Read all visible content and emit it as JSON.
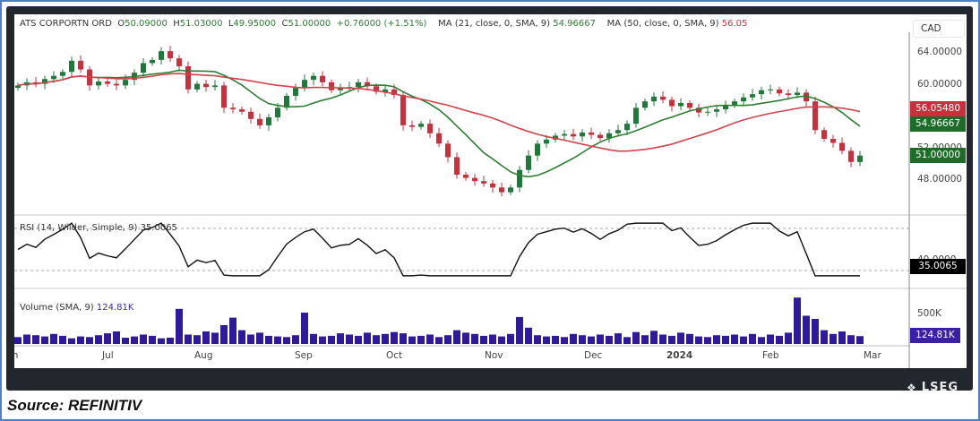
{
  "header": {
    "symbol": "ATS CORPORTN ORD",
    "open": "O50.09000",
    "high": "H51.03000",
    "low": "L49.95000",
    "close": "C51.00000",
    "change": "+0.76000 (+1.51%)",
    "ma21_label": "MA (21, close, 0, SMA, 9)",
    "ma21_value": "54.96667",
    "ma50_label": "MA (50, close, 0, SMA, 9)",
    "ma50_value": "56.05"
  },
  "currency": "CAD",
  "price_axis": [
    "64.00000",
    "60.00000",
    "52.00000",
    "48.00000"
  ],
  "price_tags": {
    "ma50": "56.05480",
    "ma21": "54.96667",
    "last": "51.00000"
  },
  "rsi": {
    "label": "RSI (14, Wilder, Simple, 9)",
    "value": "35.0065",
    "axis": "40.0000"
  },
  "volume": {
    "label": "Volume (SMA, 9)",
    "value": "124.81K",
    "axis": "500K"
  },
  "time_axis": [
    "Jun",
    "Jul",
    "Aug",
    "Sep",
    "Oct",
    "Nov",
    "Dec",
    "2024",
    "Feb",
    "Mar"
  ],
  "brand": "LSEG",
  "source": "Source: REFINITIV",
  "colors": {
    "up": "#1f7a3a",
    "down": "#cc2f3c",
    "ma21": "#2e7d32",
    "ma50": "#d2424b",
    "volume": "#2f1a9c",
    "rsi": "#111111"
  },
  "chart_data": {
    "type": "candlestick",
    "title": "ATS CORPORTN ORD",
    "ylabel": "CAD",
    "ylim": [
      44,
      66
    ],
    "closes": [
      59.8,
      60.2,
      60.0,
      60.6,
      61.0,
      61.5,
      62.9,
      61.8,
      59.8,
      60.3,
      60.0,
      59.8,
      60.5,
      61.4,
      62.6,
      63.0,
      64.1,
      63.2,
      62.2,
      59.3,
      60.0,
      59.6,
      59.8,
      57.0,
      56.8,
      56.5,
      55.6,
      54.8,
      55.8,
      57.0,
      58.5,
      59.5,
      60.5,
      61.0,
      60.2,
      59.2,
      59.5,
      59.6,
      60.2,
      59.7,
      59.0,
      59.3,
      58.6,
      54.8,
      54.6,
      55.0,
      53.8,
      52.5,
      50.8,
      48.6,
      48.2,
      47.8,
      47.5,
      47.0,
      46.4,
      47.0,
      49.2,
      51.0,
      52.5,
      53.0,
      53.5,
      53.7,
      53.4,
      53.9,
      53.6,
      53.2,
      53.8,
      54.2,
      55.0,
      57.0,
      57.8,
      58.4,
      58.0,
      57.2,
      57.6,
      57.0,
      56.4,
      56.5,
      56.8,
      57.3,
      57.8,
      58.3,
      58.7,
      59.2,
      59.3,
      58.8,
      58.6,
      58.9,
      57.8,
      54.2,
      53.1,
      52.6,
      51.6,
      50.2,
      51.0
    ],
    "volumes_k": [
      110,
      150,
      140,
      120,
      160,
      130,
      90,
      120,
      110,
      140,
      170,
      200,
      100,
      120,
      150,
      130,
      90,
      100,
      560,
      150,
      140,
      200,
      180,
      300,
      420,
      220,
      150,
      180,
      130,
      120,
      110,
      140,
      500,
      160,
      120,
      130,
      170,
      150,
      130,
      180,
      140,
      160,
      190,
      170,
      120,
      130,
      150,
      110,
      140,
      220,
      180,
      160,
      130,
      150,
      120,
      160,
      430,
      260,
      140,
      120,
      130,
      110,
      160,
      140,
      120,
      150,
      130,
      170,
      110,
      190,
      140,
      210,
      150,
      130,
      180,
      160,
      120,
      110,
      140,
      130,
      150,
      120,
      160,
      110,
      150,
      130,
      180,
      740,
      450,
      400,
      220,
      160,
      200,
      140,
      125
    ],
    "rsi_levels": [
      70,
      30
    ]
  }
}
